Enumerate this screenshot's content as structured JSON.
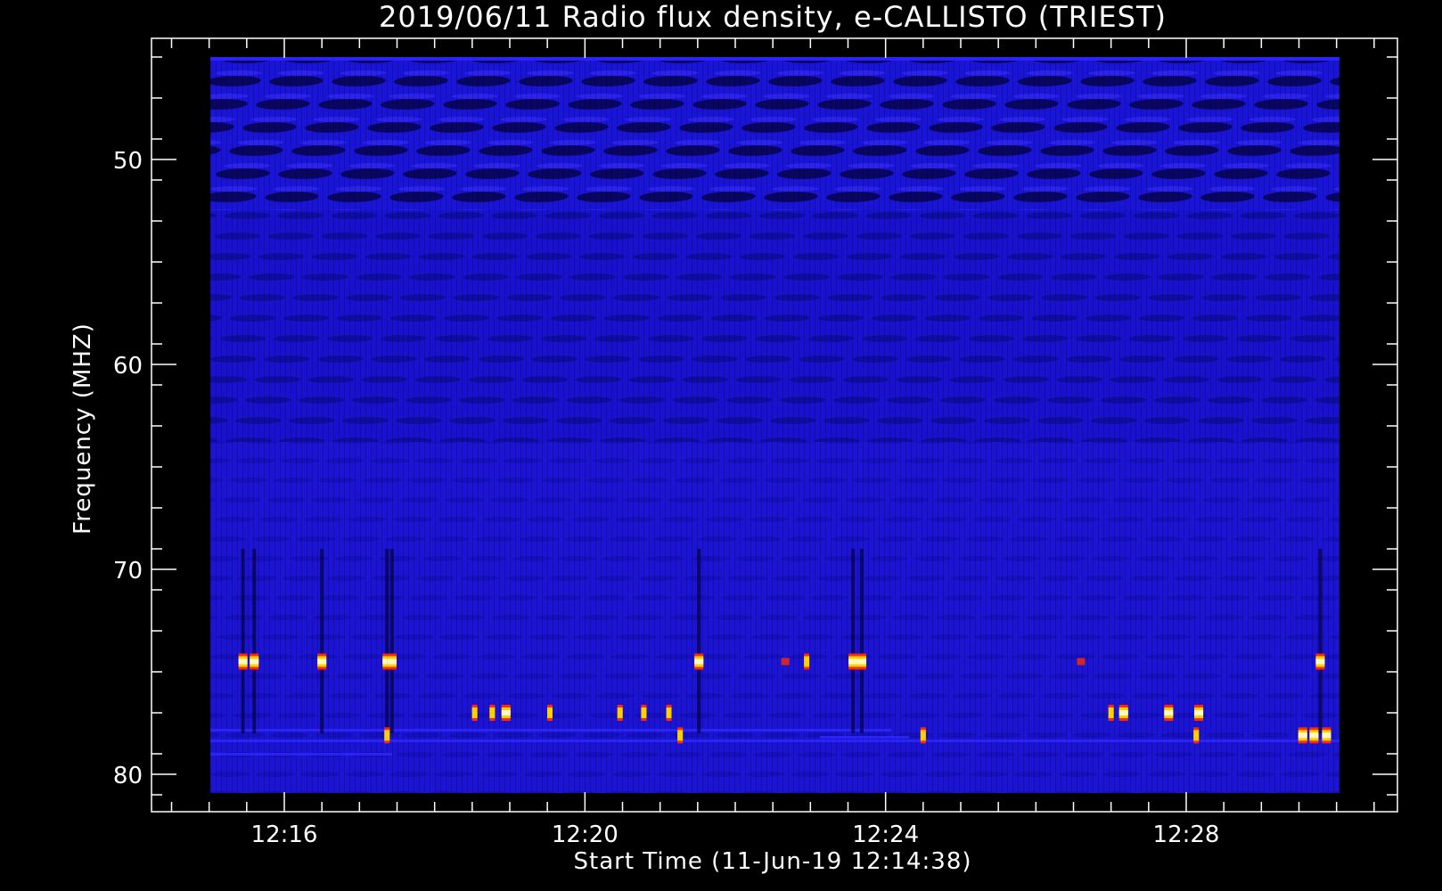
{
  "colors": {
    "background": "#000000",
    "foreground": "#ffffff",
    "spectrogram_base": "#1a13d8",
    "spectrogram_band": "#0a0896",
    "burst_core": "#fff8c0",
    "burst_mid": "#ffd000",
    "burst_edge": "#ff2a00"
  },
  "chart_data": {
    "type": "heatmap",
    "title": "2019/06/11  Radio flux density, e-CALLISTO (TRIEST)",
    "xlabel": "Start Time (11-Jun-19 12:14:38)",
    "ylabel": "Frequency (MHZ)",
    "x_range_minutes": [
      12.25,
      12.52
    ],
    "data_x_range": [
      "12:15:00",
      "12:30:00"
    ],
    "y_range_mhz": [
      45,
      82
    ],
    "y_inverted": true,
    "x_ticks": [
      "12:16",
      "12:20",
      "12:24",
      "12:28"
    ],
    "x_tick_values_min": [
      16,
      20,
      24,
      28
    ],
    "y_ticks": [
      50,
      60,
      70,
      80
    ],
    "colormap": "blue-red-yellow-white",
    "bursts": [
      {
        "time": "12:15:27",
        "freq_mhz": 74.5,
        "intensity": "high"
      },
      {
        "time": "12:15:36",
        "freq_mhz": 74.5,
        "intensity": "high"
      },
      {
        "time": "12:16:30",
        "freq_mhz": 74.5,
        "intensity": "high"
      },
      {
        "time": "12:17:22",
        "freq_mhz": 74.5,
        "intensity": "high"
      },
      {
        "time": "12:17:26",
        "freq_mhz": 74.5,
        "intensity": "high"
      },
      {
        "time": "12:17:22",
        "freq_mhz": 78.1,
        "intensity": "medium"
      },
      {
        "time": "12:18:32",
        "freq_mhz": 77.0,
        "intensity": "medium"
      },
      {
        "time": "12:18:46",
        "freq_mhz": 77.0,
        "intensity": "medium"
      },
      {
        "time": "12:18:57",
        "freq_mhz": 77.0,
        "intensity": "high"
      },
      {
        "time": "12:19:32",
        "freq_mhz": 77.0,
        "intensity": "medium"
      },
      {
        "time": "12:20:28",
        "freq_mhz": 77.0,
        "intensity": "medium"
      },
      {
        "time": "12:20:47",
        "freq_mhz": 77.0,
        "intensity": "medium"
      },
      {
        "time": "12:21:07",
        "freq_mhz": 77.0,
        "intensity": "medium"
      },
      {
        "time": "12:21:16",
        "freq_mhz": 78.1,
        "intensity": "medium"
      },
      {
        "time": "12:21:31",
        "freq_mhz": 74.5,
        "intensity": "high"
      },
      {
        "time": "12:22:40",
        "freq_mhz": 74.5,
        "intensity": "low"
      },
      {
        "time": "12:22:57",
        "freq_mhz": 74.5,
        "intensity": "medium"
      },
      {
        "time": "12:23:34",
        "freq_mhz": 74.5,
        "intensity": "high"
      },
      {
        "time": "12:23:41",
        "freq_mhz": 74.5,
        "intensity": "high"
      },
      {
        "time": "12:24:30",
        "freq_mhz": 78.1,
        "intensity": "medium"
      },
      {
        "time": "12:26:36",
        "freq_mhz": 74.5,
        "intensity": "low"
      },
      {
        "time": "12:27:00",
        "freq_mhz": 77.0,
        "intensity": "medium"
      },
      {
        "time": "12:27:10",
        "freq_mhz": 77.0,
        "intensity": "high"
      },
      {
        "time": "12:27:46",
        "freq_mhz": 77.0,
        "intensity": "high"
      },
      {
        "time": "12:28:10",
        "freq_mhz": 77.0,
        "intensity": "high"
      },
      {
        "time": "12:28:08",
        "freq_mhz": 78.1,
        "intensity": "medium"
      },
      {
        "time": "12:29:33",
        "freq_mhz": 78.1,
        "intensity": "high"
      },
      {
        "time": "12:29:42",
        "freq_mhz": 78.1,
        "intensity": "high"
      },
      {
        "time": "12:29:52",
        "freq_mhz": 78.1,
        "intensity": "high"
      },
      {
        "time": "12:29:47",
        "freq_mhz": 74.5,
        "intensity": "high"
      }
    ]
  }
}
